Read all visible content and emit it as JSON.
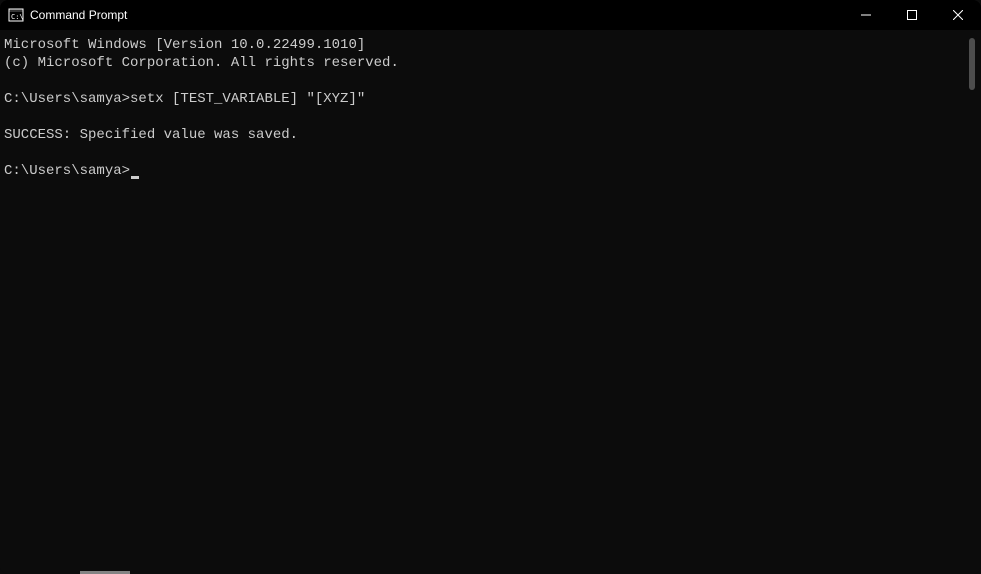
{
  "titlebar": {
    "title": "Command Prompt"
  },
  "terminal": {
    "lines": [
      "Microsoft Windows [Version 10.0.22499.1010]",
      "(c) Microsoft Corporation. All rights reserved.",
      "",
      "C:\\Users\\samya>setx [TEST_VARIABLE] \"[XYZ]\"",
      "",
      "SUCCESS: Specified value was saved.",
      "",
      "C:\\Users\\samya>"
    ]
  }
}
